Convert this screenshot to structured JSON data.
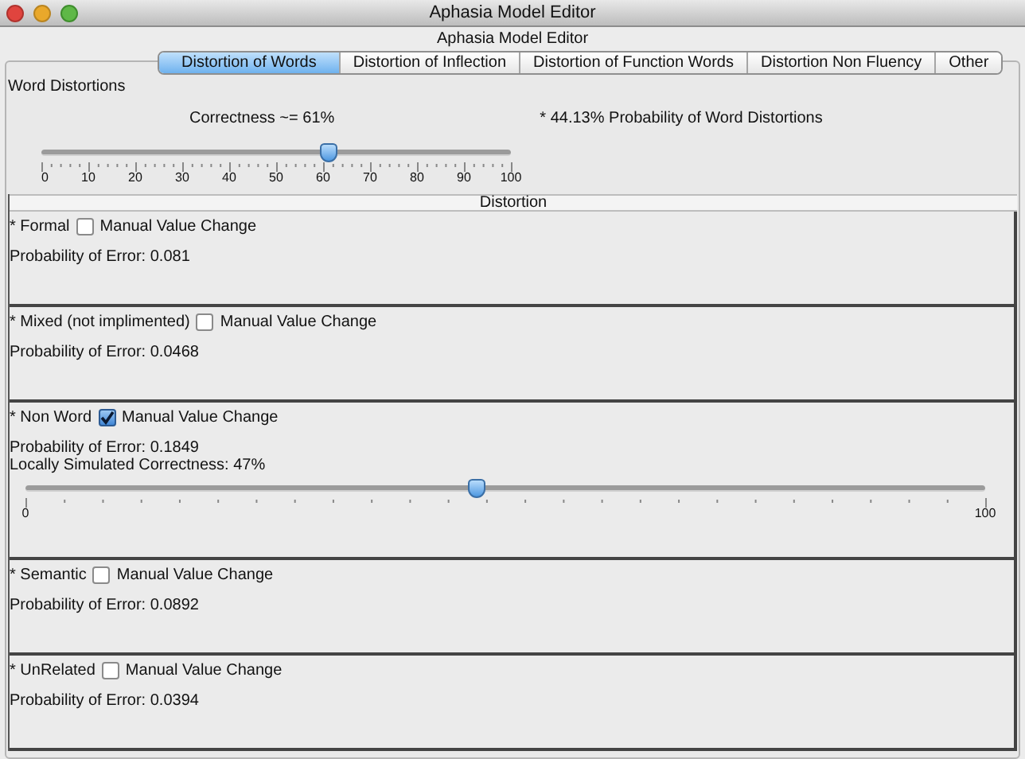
{
  "window": {
    "title": "Aphasia Model Editor"
  },
  "header": "Aphasia Model Editor",
  "tabs": [
    {
      "label": "Distortion of Words",
      "selected": true
    },
    {
      "label": "Distortion of Inflection",
      "selected": false
    },
    {
      "label": "Distortion of Function Words",
      "selected": false
    },
    {
      "label": "Distortion Non Fluency",
      "selected": false
    },
    {
      "label": "Other",
      "selected": false
    }
  ],
  "panel": {
    "title": "Word Distortions",
    "correctness": "Correctness ~= 61%",
    "probability": "* 44.13% Probability of Word Distortions",
    "slider": {
      "level": 0.61,
      "labels": [
        "0",
        "10",
        "20",
        "30",
        "40",
        "50",
        "60",
        "70",
        "80",
        "90",
        "100"
      ]
    }
  },
  "distortion_header": "Distortion",
  "distortions": [
    {
      "kind": "plain",
      "name": "* Formal",
      "checkbox_label": "Manual Value Change",
      "checked": false,
      "probability": "Probability of Error: 0.081"
    },
    {
      "kind": "plain",
      "name": "* Mixed (not implimented)",
      "checkbox_label": "Manual Value Change",
      "checked": false,
      "probability": "Probability of Error: 0.0468"
    },
    {
      "kind": "slider",
      "name": "* Non Word",
      "checkbox_label": "Manual Value Change",
      "checked": true,
      "probability": "Probability of Error: 0.1849",
      "reading": "Locally Simulated Correctness: 47%",
      "level": 0.47,
      "min_label": "0",
      "max_label": "100"
    },
    {
      "kind": "plain",
      "name": "* Semantic",
      "checkbox_label": "Manual Value Change",
      "checked": false,
      "probability": "Probability of Error: 0.0892"
    },
    {
      "kind": "plain",
      "name": "* UnRelated",
      "checkbox_label": "Manual Value Change",
      "checked": false,
      "probability": "Probability of Error: 0.0394"
    }
  ]
}
